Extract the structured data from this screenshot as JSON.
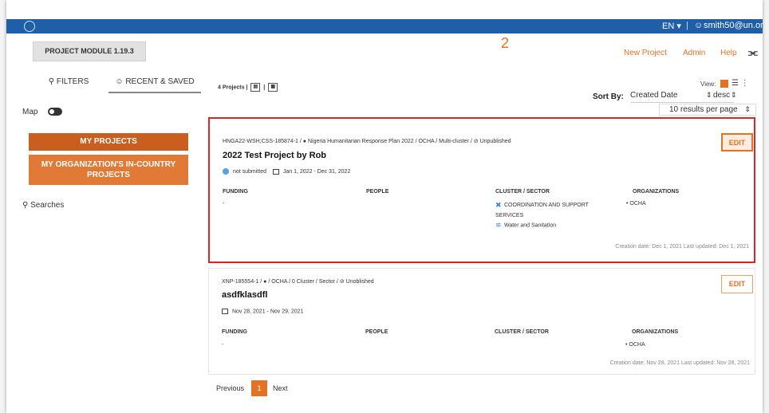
{
  "topbar": {
    "language": "EN ▾",
    "separator": "|",
    "user_icon": "person-icon",
    "user": "smith50@un.org"
  },
  "header": {
    "module_label": "PROJECT MODULE 1.19.3",
    "step_number": "2",
    "links": [
      "New Project",
      "Admin",
      "Help"
    ],
    "rss_icon": "rss-icon"
  },
  "sidebar": {
    "tabs": [
      {
        "icon": "search-icon",
        "label": "FILTERS"
      },
      {
        "icon": "person-icon",
        "label": "RECENT & SAVED"
      }
    ],
    "map_label": "Map",
    "map_toggle": "off",
    "my_projects": "MY PROJECTS",
    "my_org_projects": "MY ORGANIZATION'S IN-COUNTRY PROJECTS",
    "searches": "Searches"
  },
  "listing": {
    "count": "4 Projects |",
    "view_label": "View:",
    "sort_label": "Sort By:",
    "sort_value": "Created Date",
    "sort_direction": "desc",
    "per_page": "10 results per page"
  },
  "projects": [
    {
      "code": "HNGA22-WSH;CSS-185874-1 /",
      "context": "Nigeria Humanitarian Response Plan 2022 / OCHA / Multi-cluster /",
      "visibility": "Unpublished",
      "title": "2022 Test Project by Rob",
      "status": "not submitted",
      "date_range": "Jan 1, 2022 - Dec 31, 2022",
      "funding_header": "FUNDING",
      "funding": "-",
      "people_header": "PEOPLE",
      "cluster_header": "CLUSTER / SECTOR",
      "clusters": [
        "COORDINATION AND SUPPORT SERVICES",
        "Water and Sanitation"
      ],
      "org_header": "ORGANIZATIONS",
      "organizations": [
        "• OCHA"
      ],
      "edit_label": "EDIT",
      "dates": "Creation date: Dec 1, 2021   Last updated: Dec 1, 2021"
    },
    {
      "code": "XNP-185554-1 /",
      "context": "/ OCHA / 0 Cluster / Sector /",
      "visibility": "Unoblished",
      "title": "asdfklasdfl",
      "date_range": "Nov 28, 2021 - Nov 29, 2021",
      "funding_header": "FUNDING",
      "funding": "-",
      "people_header": "PEOPLE",
      "cluster_header": "CLUSTER / SECTOR",
      "org_header": "ORGANIZATIONS",
      "organizations": [
        "• OCHA"
      ],
      "edit_label": "EDIT",
      "dates": "Creation date: Nov 28, 2021   Last updated: Nov 28, 2021"
    }
  ],
  "pagination": {
    "previous": "Previous",
    "current": "1",
    "next": "Next"
  },
  "colors": {
    "topbar": "#1f5fa8",
    "accent": "#e37222",
    "highlight": "#e02424"
  }
}
